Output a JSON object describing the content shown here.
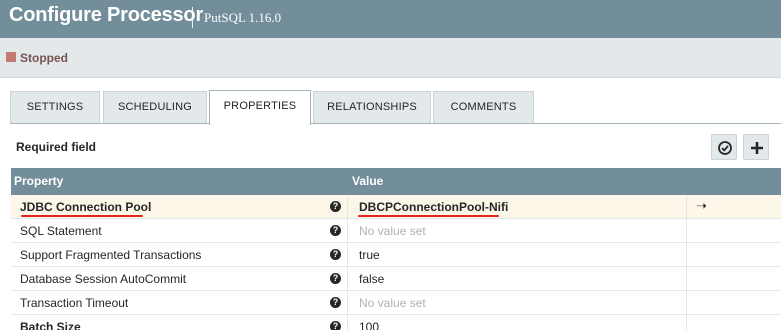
{
  "header": {
    "title": "Configure Processor",
    "processor": "PutSQL 1.16.0"
  },
  "status": {
    "label": "Stopped",
    "color": "#ba554a"
  },
  "tabs": [
    {
      "label": "SETTINGS",
      "active": false
    },
    {
      "label": "SCHEDULING",
      "active": false
    },
    {
      "label": "PROPERTIES",
      "active": true
    },
    {
      "label": "RELATIONSHIPS",
      "active": false
    },
    {
      "label": "COMMENTS",
      "active": false
    }
  ],
  "properties": {
    "required_label": "Required field",
    "verify_icon": "check-circle-icon",
    "add_icon": "plus-icon",
    "columns": {
      "property": "Property",
      "value": "Value"
    },
    "rows": [
      {
        "name": "JDBC Connection Pool",
        "value": "DBCPConnectionPool-Nifi",
        "required": true,
        "unset": false
      },
      {
        "name": "SQL Statement",
        "value": "No value set",
        "required": false,
        "unset": true
      },
      {
        "name": "Support Fragmented Transactions",
        "value": "true",
        "required": false,
        "unset": false
      },
      {
        "name": "Database Session AutoCommit",
        "value": "false",
        "required": false,
        "unset": false
      },
      {
        "name": "Transaction Timeout",
        "value": "No value set",
        "required": false,
        "unset": true
      },
      {
        "name": "Batch Size",
        "value": "100",
        "required": true,
        "unset": false
      }
    ],
    "goto_icon": "arrow-right-icon"
  },
  "colors": {
    "header_bg": "#728e9b",
    "tab_bg": "#e3e8eb",
    "selected_row": "#fcf7e8",
    "annotation": "#e8231f"
  }
}
